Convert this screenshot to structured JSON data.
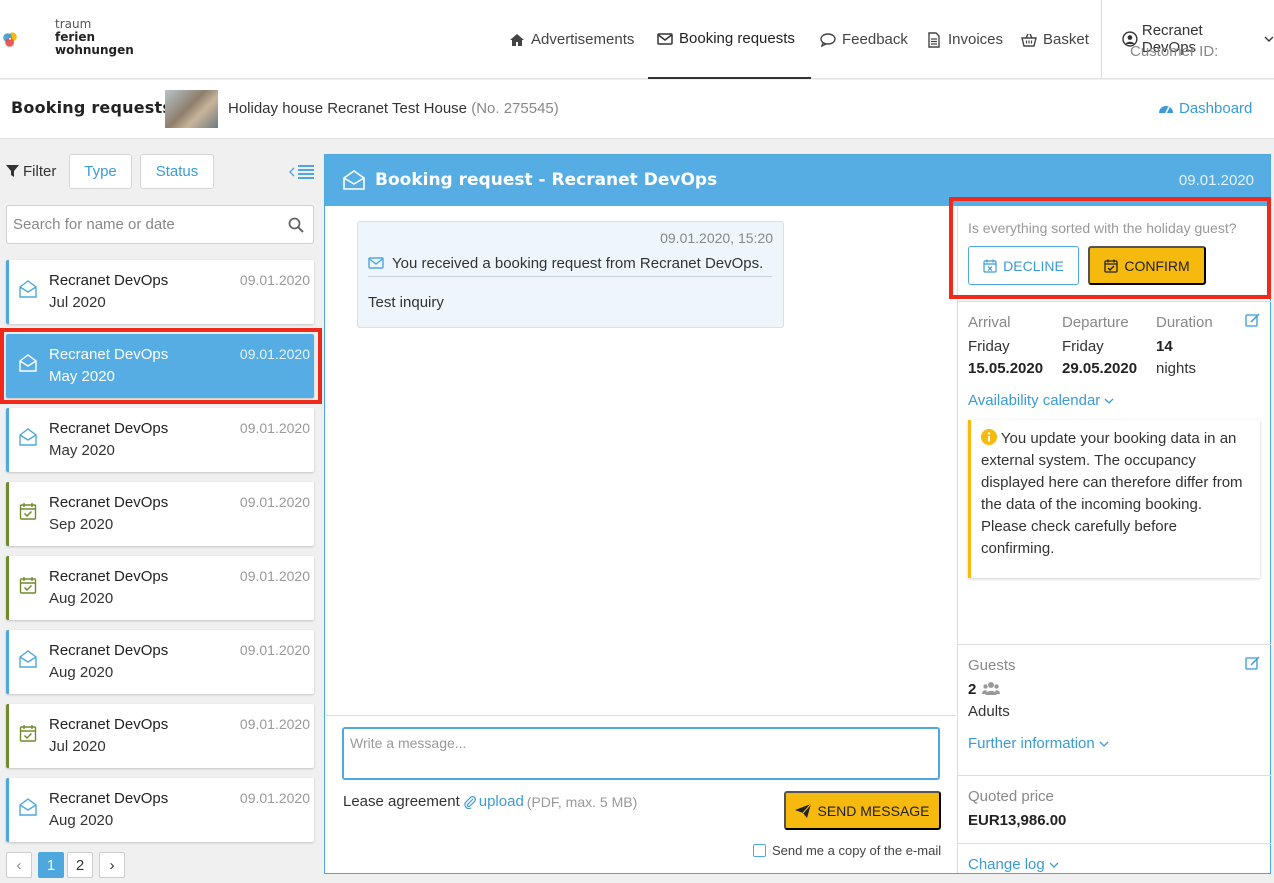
{
  "logo": {
    "line1": "traum",
    "line2": "ferien",
    "line3": "wohnungen"
  },
  "nav": {
    "advertisements": "Advertisements",
    "booking_requests": "Booking requests",
    "feedback": "Feedback",
    "invoices": "Invoices",
    "basket": "Basket"
  },
  "account": {
    "name": "Recranet DevOps",
    "customer_id": "Customer ID:"
  },
  "subheader": {
    "title": "Booking requests",
    "house": "Holiday house Recranet Test House",
    "house_no": "(No. 275545)",
    "dashboard": "Dashboard"
  },
  "filter": {
    "label": "Filter",
    "type": "Type",
    "status": "Status",
    "search_placeholder": "Search for name or date"
  },
  "requests": [
    {
      "name": "Recranet DevOps",
      "month": "Jul 2020",
      "date": "09.01.2020",
      "icon": "envelope-open-icon"
    },
    {
      "name": "Recranet DevOps",
      "month": "May 2020",
      "date": "09.01.2020",
      "icon": "envelope-open-icon"
    },
    {
      "name": "Recranet DevOps",
      "month": "May 2020",
      "date": "09.01.2020",
      "icon": "envelope-open-icon"
    },
    {
      "name": "Recranet DevOps",
      "month": "Sep 2020",
      "date": "09.01.2020",
      "icon": "calendar-check-icon"
    },
    {
      "name": "Recranet DevOps",
      "month": "Aug 2020",
      "date": "09.01.2020",
      "icon": "calendar-check-icon"
    },
    {
      "name": "Recranet DevOps",
      "month": "Aug 2020",
      "date": "09.01.2020",
      "icon": "envelope-open-icon"
    },
    {
      "name": "Recranet DevOps",
      "month": "Jul 2020",
      "date": "09.01.2020",
      "icon": "calendar-check-icon"
    },
    {
      "name": "Recranet DevOps",
      "month": "Aug 2020",
      "date": "09.01.2020",
      "icon": "envelope-open-icon"
    }
  ],
  "pagination": {
    "prev": "‹",
    "page1": "1",
    "page2": "2",
    "next": "›"
  },
  "main": {
    "title": "Booking request - Recranet DevOps",
    "date": "09.01.2020",
    "message": {
      "timestamp": "09.01.2020, 15:20",
      "headline": "You received a booking request from Recranet DevOps.",
      "body": "Test inquiry"
    },
    "compose_placeholder": "Write a message...",
    "lease_label": "Lease agreement",
    "upload": "upload",
    "upload_hint": "(PDF, max. 5 MB)",
    "send": "SEND MESSAGE",
    "copy": "Send me a copy of the e-mail"
  },
  "details": {
    "question": "Is everything sorted with the holiday guest?",
    "decline": "DECLINE",
    "confirm": "CONFIRM",
    "arrival_label": "Arrival",
    "arrival_day": "Friday",
    "arrival_date": "15.05.2020",
    "departure_label": "Departure",
    "departure_day": "Friday",
    "departure_date": "29.05.2020",
    "duration_label": "Duration",
    "duration_value": "14",
    "duration_unit": "nights",
    "availability": "Availability calendar",
    "notice": "You update your booking data in an external system. The occupancy displayed here can therefore differ from the data of the incoming booking. Please check carefully before confirming.",
    "guests_label": "Guests",
    "guests_count": "2",
    "guests_type": "Adults",
    "further_info": "Further information",
    "price_label": "Quoted price",
    "price_value": "EUR13,986.00",
    "change_log": "Change log"
  },
  "colors": {
    "accent": "#56ade3",
    "link": "#3a9bd6",
    "confirm": "#f6b90d",
    "highlight": "#ef2a1c",
    "green": "#6e8c2b"
  }
}
